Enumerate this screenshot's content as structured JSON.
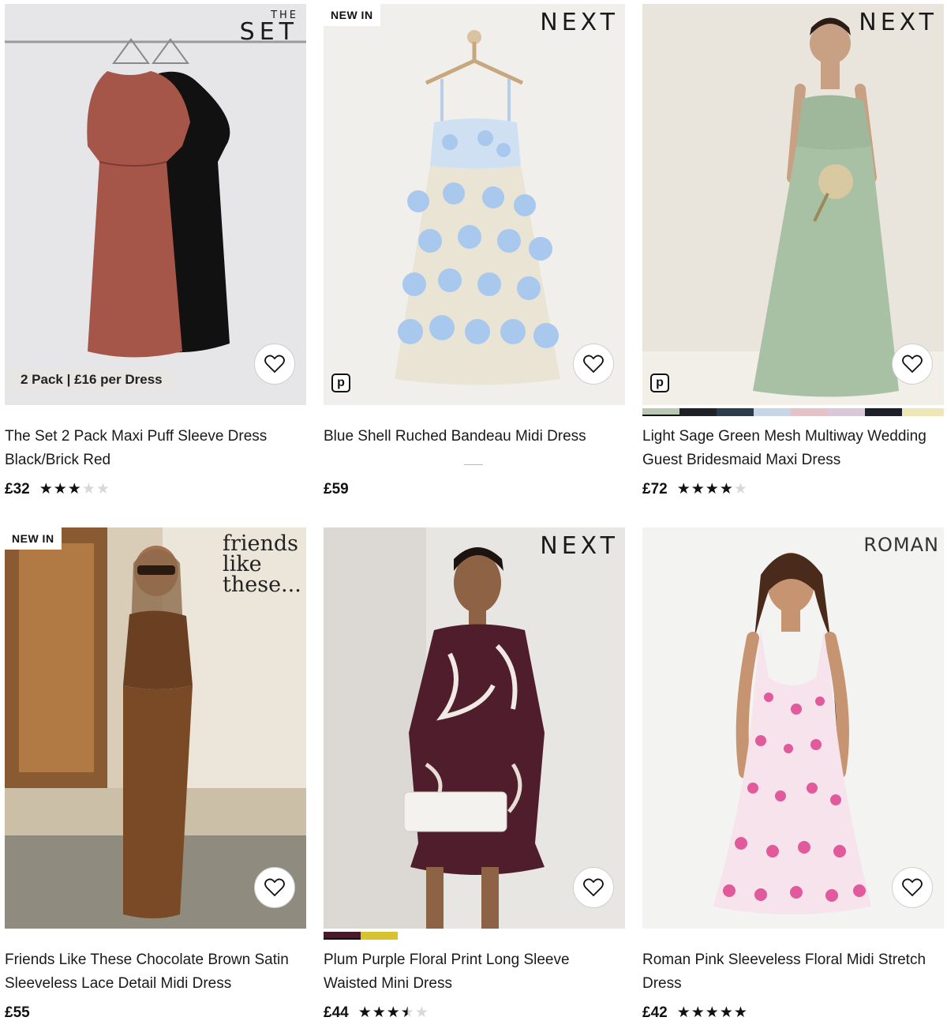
{
  "products": [
    {
      "brand_lines": [
        "THE",
        "SET"
      ],
      "badge": "",
      "banner": "2 Pack | £16 per Dress",
      "title": "The Set 2 Pack Maxi Puff Sleeve Dress Black/Brick Red",
      "price": "£32",
      "rating": 3,
      "favourite_icon": "heart-icon"
    },
    {
      "brand": "NEXT",
      "badge": "NEW IN",
      "title": "Blue Shell Ruched Bandeau Midi Dress",
      "price": "£59",
      "rating": null,
      "partner_icon": "p-badge-icon",
      "partner_letter": "p",
      "favourite_icon": "heart-icon"
    },
    {
      "brand": "NEXT",
      "badge": "",
      "title": "Light Sage Green Mesh Multiway Wedding Guest Bridesmaid Maxi Dress",
      "price": "£72",
      "rating": 4,
      "partner_icon": "p-badge-icon",
      "partner_letter": "p",
      "swatch_colors": [
        "#b9c8b3",
        "#1f2126",
        "#2b3c4a",
        "#c7d6e4",
        "#e3c3c8",
        "#d9c8d9",
        "#1d1f29",
        "#efe6b8"
      ],
      "favourite_icon": "heart-icon"
    },
    {
      "brand_lines": [
        "friends",
        "like",
        "these..."
      ],
      "badge": "NEW IN",
      "title": "Friends Like These Chocolate Brown Satin Sleeveless Lace Detail Midi Dress",
      "price": "£55",
      "rating": null,
      "favourite_icon": "heart-icon"
    },
    {
      "brand": "NEXT",
      "badge": "",
      "title": "Plum Purple Floral Print Long Sleeve Waisted Mini Dress",
      "price": "£44",
      "rating": 3.5,
      "swatch_colors": [
        "#4a1a2a",
        "#d8c22e"
      ],
      "favourite_icon": "heart-icon"
    },
    {
      "brand": "ROMAN",
      "badge": "",
      "title": "Roman Pink Sleeveless Floral Midi Stretch Dress",
      "price": "£42",
      "rating": 5,
      "favourite_icon": "heart-icon"
    }
  ]
}
